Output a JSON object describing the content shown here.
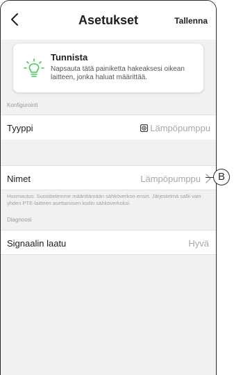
{
  "header": {
    "title": "Asetukset",
    "save_label": "Tallenna"
  },
  "identify": {
    "title": "Tunnista",
    "description": "Napsauta tätä painiketta hakeaksesi oikean laitteen, jonka haluat määrittää.",
    "icon": "lightbulb-icon"
  },
  "configuration": {
    "section_label": "Konfigurointi",
    "rows": [
      {
        "label": "Tyyppi",
        "value": "Lämpöpumppu",
        "icon": "heat-pump-icon"
      },
      {
        "label": "Nimet",
        "value": "Lämpöpumppu",
        "icon": "chevron-right-icon"
      }
    ],
    "note": "Huomautus: Suosittelemme määrittämään sähköverkon ensin. Järjestelmä sallii vain yhden PTE-laitteen asettamisen kodin sähköverkoksi."
  },
  "diagnostics": {
    "section_label": "Diagnoosi",
    "rows": [
      {
        "label": "Signaalin laatu",
        "value": "Hyvä"
      }
    ]
  },
  "callout": {
    "label": "B"
  },
  "colors": {
    "background": "#f1f1f1",
    "accent_green": "#3dcd58",
    "text": "#1e1e1e",
    "muted": "#a8a8a8"
  }
}
